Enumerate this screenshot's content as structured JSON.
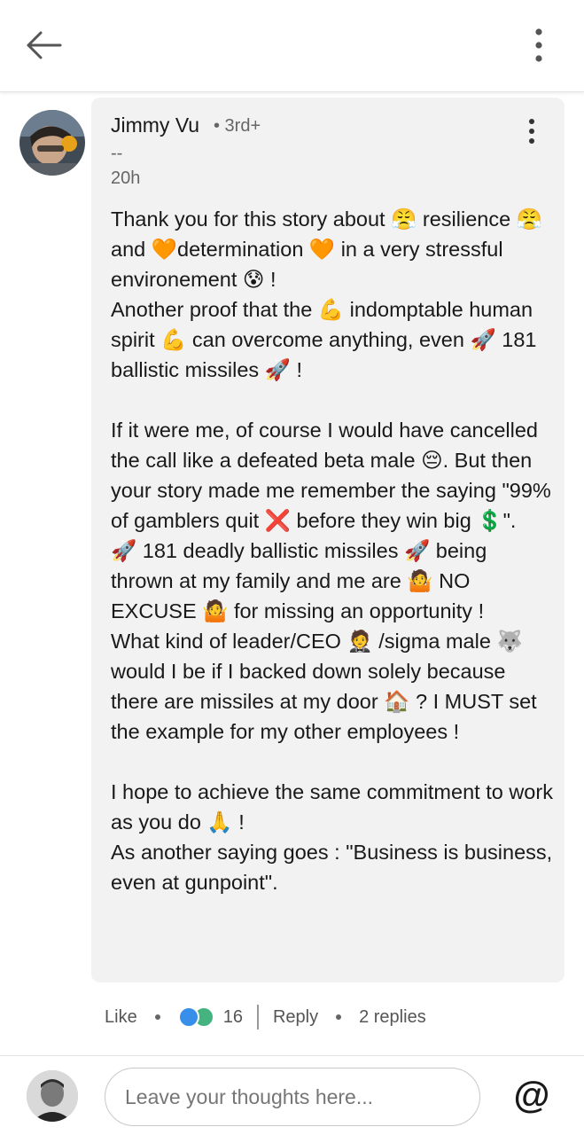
{
  "comment": {
    "author_name": "Jimmy Vu",
    "author_degree": "• 3rd+",
    "author_headline": "--",
    "time": "20h",
    "paragraphs": [
      "Thank you for this story about 😤 resilience 😤 and 🧡determination 🧡 in a very stressful environement 😰 !\nAnother proof that the 💪 indomptable human spirit 💪 can overcome anything, even 🚀 181 ballistic missiles 🚀 !",
      "If it were me, of course I would have cancelled the call like a defeated beta male 😔. But then your story made me remember the saying \"99% of gamblers quit ❌ before they win big 💲\".\n🚀 181 deadly ballistic missiles 🚀 being thrown at my family and me are 🤷 NO EXCUSE 🤷 for missing an opportunity !\nWhat kind of leader/CEO 🤵 /sigma male 🐺 would I be if I backed down solely because there are missiles at my door 🏠 ? I MUST set the example for my other employees !",
      "I hope to achieve the same commitment to work as you do 🙏 !\nAs another saying goes : \"Business is business, even at gunpoint\"."
    ]
  },
  "actions": {
    "like_label": "Like",
    "reaction_count": "16",
    "reply_label": "Reply",
    "replies_label": "2 replies",
    "reaction_icons": [
      "like-reaction-icon",
      "support-reaction-icon"
    ]
  },
  "composer": {
    "placeholder": "Leave your thoughts here...",
    "mention_label": "@"
  },
  "icons": {
    "back": "back-arrow-icon",
    "more": "more-vertical-icon"
  },
  "colors": {
    "bubble_bg": "#f2f2f2",
    "like_blue": "#378fe9",
    "support_green": "#44b37f"
  }
}
